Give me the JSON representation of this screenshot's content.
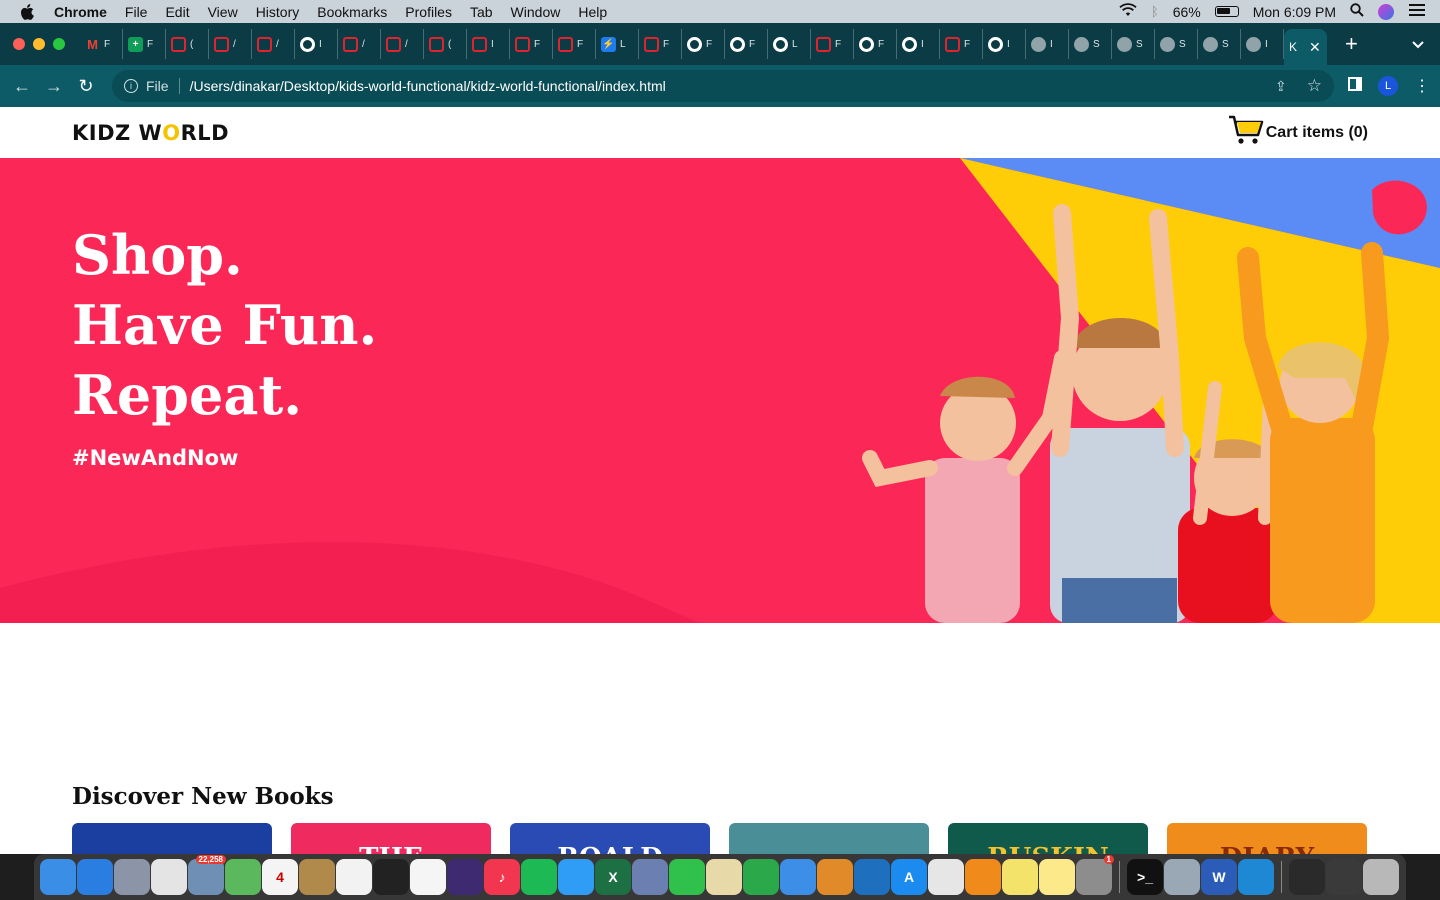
{
  "menubar": {
    "app_name": "Chrome",
    "items": [
      "File",
      "Edit",
      "View",
      "History",
      "Bookmarks",
      "Profiles",
      "Tab",
      "Window",
      "Help"
    ],
    "battery": "66%",
    "clock": "Mon 6:09 PM"
  },
  "tabs": {
    "items": [
      {
        "icon": "gmail-icon",
        "kind": "gmail",
        "glyph": "M",
        "label": "F"
      },
      {
        "icon": "sheets-icon",
        "kind": "green",
        "glyph": "+",
        "label": "F"
      },
      {
        "icon": "red-square-icon",
        "kind": "red",
        "glyph": "",
        "label": "("
      },
      {
        "icon": "red-square-icon",
        "kind": "red",
        "glyph": "",
        "label": "/"
      },
      {
        "icon": "red-square-icon",
        "kind": "red",
        "glyph": "",
        "label": "/"
      },
      {
        "icon": "github-icon",
        "kind": "gh",
        "glyph": "",
        "label": "I"
      },
      {
        "icon": "red-square-icon",
        "kind": "red",
        "glyph": "",
        "label": "/"
      },
      {
        "icon": "red-square-icon",
        "kind": "red",
        "glyph": "",
        "label": "/"
      },
      {
        "icon": "red-square-icon",
        "kind": "red",
        "glyph": "",
        "label": "("
      },
      {
        "icon": "red-square-icon",
        "kind": "red",
        "glyph": "",
        "label": "I"
      },
      {
        "icon": "red-square-icon",
        "kind": "red",
        "glyph": "",
        "label": "F"
      },
      {
        "icon": "red-square-icon",
        "kind": "red",
        "glyph": "",
        "label": "F"
      },
      {
        "icon": "lightning-icon",
        "kind": "blue",
        "glyph": "⚡",
        "label": "L"
      },
      {
        "icon": "red-square-icon",
        "kind": "red",
        "glyph": "",
        "label": "F"
      },
      {
        "icon": "github-icon",
        "kind": "gh",
        "glyph": "",
        "label": "F"
      },
      {
        "icon": "github-icon",
        "kind": "gh",
        "glyph": "",
        "label": "F"
      },
      {
        "icon": "github-icon",
        "kind": "gh",
        "glyph": "",
        "label": "L"
      },
      {
        "icon": "red-square-icon",
        "kind": "red",
        "glyph": "",
        "label": "F"
      },
      {
        "icon": "github-icon",
        "kind": "gh",
        "glyph": "",
        "label": "F"
      },
      {
        "icon": "github-icon",
        "kind": "gh",
        "glyph": "",
        "label": "I"
      },
      {
        "icon": "red-square-icon",
        "kind": "red",
        "glyph": "",
        "label": "F"
      },
      {
        "icon": "github-icon",
        "kind": "gh",
        "glyph": "",
        "label": "I"
      },
      {
        "icon": "globe-icon",
        "kind": "globe",
        "glyph": "",
        "label": "I"
      },
      {
        "icon": "globe-icon",
        "kind": "globe",
        "glyph": "",
        "label": "S"
      },
      {
        "icon": "globe-icon",
        "kind": "globe",
        "glyph": "",
        "label": "S"
      },
      {
        "icon": "globe-icon",
        "kind": "globe",
        "glyph": "",
        "label": "S"
      },
      {
        "icon": "globe-icon",
        "kind": "globe",
        "glyph": "",
        "label": "S"
      },
      {
        "icon": "globe-icon",
        "kind": "globe",
        "glyph": "",
        "label": "I"
      }
    ],
    "active_label": "K",
    "new_tab": "+"
  },
  "address_bar": {
    "scheme": "File",
    "url": "/Users/dinakar/Desktop/kids-world-functional/kidz-world-functional/index.html",
    "profile_initial": "L"
  },
  "site": {
    "logo_part1": "KIDZ W",
    "logo_o": "O",
    "logo_part2": "RLD",
    "cart_label": "Cart items (0)",
    "hero": {
      "line1": "Shop.",
      "line2": "Have Fun.",
      "line3": "Repeat.",
      "hashtag": "#NewAndNow"
    },
    "section_title": "Discover New Books",
    "books": [
      {
        "title": "",
        "bg": "#1b3fa0",
        "fg": "#ffffff"
      },
      {
        "title": "THE",
        "bg": "#ee2a5e",
        "fg": "#ffffff"
      },
      {
        "title": "ROALD",
        "bg": "#2a4bb4",
        "fg": "#ffffff"
      },
      {
        "title": "",
        "bg": "#4a8f98",
        "fg": "#ffffff"
      },
      {
        "title": "RUSKIN",
        "bg": "#0f5a4a",
        "fg": "#f2c230"
      },
      {
        "title": "DIARY",
        "bg": "#f08c1c",
        "fg": "#8a2a00"
      }
    ]
  },
  "colors": {
    "hero_bg": "#fb2857",
    "accent_yellow": "#fecd07",
    "accent_blue": "#5b8cf5"
  },
  "dock": {
    "items": [
      {
        "name": "finder-icon",
        "color": "#3a8ee6",
        "glyph": ""
      },
      {
        "name": "safari-icon",
        "color": "#2a7de1",
        "glyph": ""
      },
      {
        "name": "launchpad-icon",
        "color": "#8c95a8",
        "glyph": ""
      },
      {
        "name": "chrome-icon",
        "color": "#e4e4e4",
        "glyph": ""
      },
      {
        "name": "preview-icon",
        "color": "#6f8fb5",
        "glyph": "",
        "badge": "22,258"
      },
      {
        "name": "maps-icon",
        "color": "#5cb85c",
        "glyph": ""
      },
      {
        "name": "calendar-icon",
        "color": "#f4f4f4",
        "glyph": "4"
      },
      {
        "name": "notes-book-icon",
        "color": "#b08a4a",
        "glyph": ""
      },
      {
        "name": "reminders-icon",
        "color": "#f2f2f2",
        "glyph": ""
      },
      {
        "name": "stocks-icon",
        "color": "#222222",
        "glyph": ""
      },
      {
        "name": "photos-icon",
        "color": "#f5f5f5",
        "glyph": ""
      },
      {
        "name": "siri-icon",
        "color": "#3d2a70",
        "glyph": ""
      },
      {
        "name": "music-icon",
        "color": "#f3364f",
        "glyph": "♪"
      },
      {
        "name": "spotify-icon",
        "color": "#1db954",
        "glyph": ""
      },
      {
        "name": "messages-icon",
        "color": "#2f9cf6",
        "glyph": ""
      },
      {
        "name": "excel-icon",
        "color": "#1d7044",
        "glyph": "X"
      },
      {
        "name": "noentry-icon",
        "color": "#6b7fb0",
        "glyph": ""
      },
      {
        "name": "facetime-icon",
        "color": "#2fc14c",
        "glyph": ""
      },
      {
        "name": "textedit-icon",
        "color": "#e8d9a8",
        "glyph": ""
      },
      {
        "name": "numbers-icon",
        "color": "#2aa84a",
        "glyph": ""
      },
      {
        "name": "keynote-icon",
        "color": "#3d8ee6",
        "glyph": ""
      },
      {
        "name": "garageband-icon",
        "color": "#e08a2a",
        "glyph": ""
      },
      {
        "name": "edge-icon",
        "color": "#1f6fbf",
        "glyph": ""
      },
      {
        "name": "appstore-icon",
        "color": "#1b8bf0",
        "glyph": "A"
      },
      {
        "name": "script-editor-icon",
        "color": "#e6e6e6",
        "glyph": ""
      },
      {
        "name": "home-icon",
        "color": "#f08a1a",
        "glyph": ""
      },
      {
        "name": "stickies-icon",
        "color": "#f4e36a",
        "glyph": ""
      },
      {
        "name": "notes-icon",
        "color": "#fbe98a",
        "glyph": ""
      },
      {
        "name": "system-preferences-icon",
        "color": "#8d8d8d",
        "glyph": "",
        "badge": "1"
      },
      {
        "name": "terminal-icon",
        "color": "#111111",
        "glyph": ">_"
      },
      {
        "name": "screenshot-icon",
        "color": "#9aa7b5",
        "glyph": ""
      },
      {
        "name": "word-icon",
        "color": "#2b5cb8",
        "glyph": "W"
      },
      {
        "name": "vscode-icon",
        "color": "#1e88d4",
        "glyph": ""
      },
      {
        "name": "minimized-window-icon",
        "color": "#2a2a2a",
        "glyph": ""
      },
      {
        "name": "minimized-window-icon-2",
        "color": "#3a3a3a",
        "glyph": ""
      },
      {
        "name": "trash-icon",
        "color": "#b8b8b8",
        "glyph": ""
      }
    ]
  }
}
